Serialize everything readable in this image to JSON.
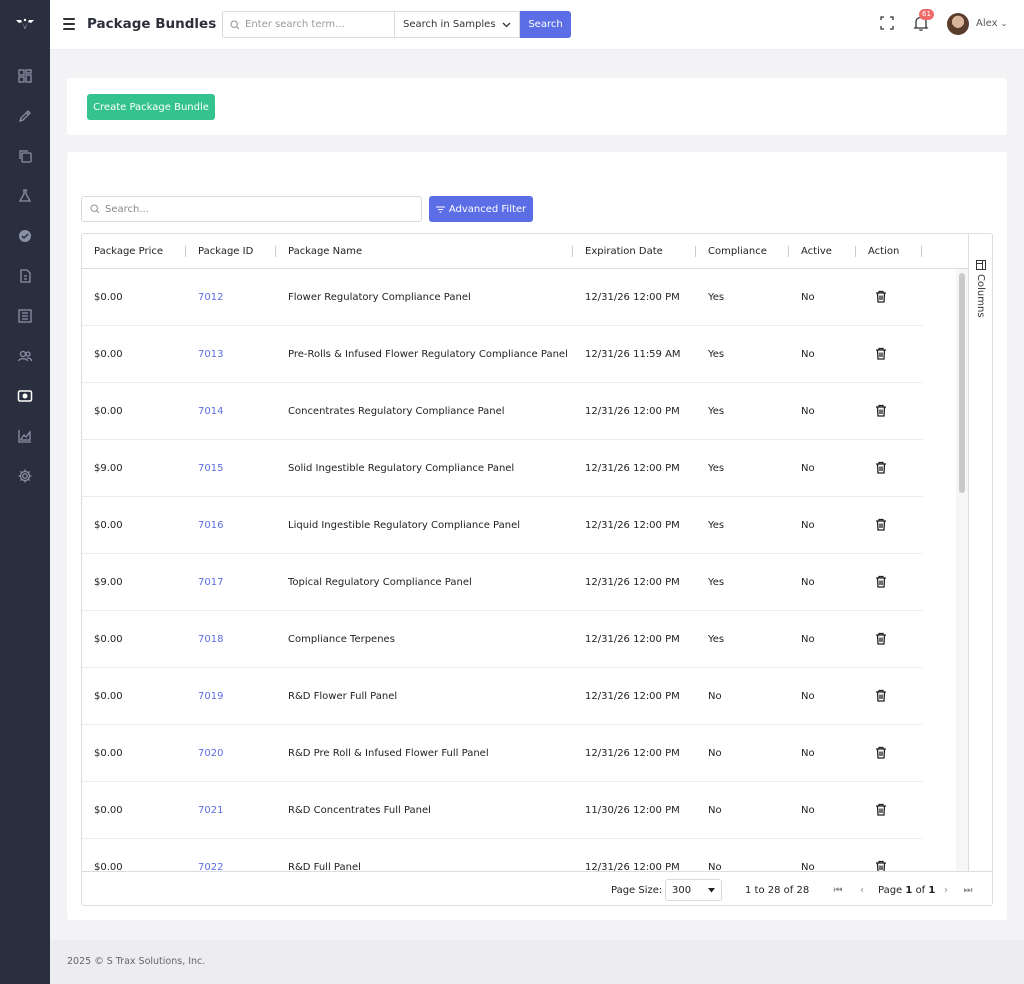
{
  "sidebar": {
    "logo": "trax-logo-icon",
    "items": [
      {
        "icon": "dashboard-icon"
      },
      {
        "icon": "pencil-icon"
      },
      {
        "icon": "copy-icon"
      },
      {
        "icon": "flask-icon"
      },
      {
        "icon": "verified-badge-icon"
      },
      {
        "icon": "document-icon"
      },
      {
        "icon": "list-icon"
      },
      {
        "icon": "users-icon"
      },
      {
        "icon": "package-icon"
      },
      {
        "icon": "area-chart-icon"
      },
      {
        "icon": "gear-icon"
      }
    ]
  },
  "header": {
    "title": "Package Bundles",
    "search_placeholder": "Enter search term...",
    "search_scope": "Search in Samples",
    "search_button": "Search",
    "notification_count": "61",
    "user_name": "Alex"
  },
  "toolbar": {
    "create_label": "Create Package Bundle"
  },
  "table": {
    "search_placeholder": "Search...",
    "filter_label": "Advanced Filter",
    "columns_label": "Columns",
    "headers": [
      "Package Price",
      "Package ID",
      "Package Name",
      "Expiration Date",
      "Compliance",
      "Active",
      "Action"
    ],
    "rows": [
      {
        "price": "$0.00",
        "id": "7012",
        "name": "Flower Regulatory Compliance Panel",
        "expiration": "12/31/26 12:00 PM",
        "compliance": "Yes",
        "active": "No"
      },
      {
        "price": "$0.00",
        "id": "7013",
        "name": "Pre-Rolls & Infused Flower Regulatory Compliance Panel",
        "expiration": "12/31/26 11:59 AM",
        "compliance": "Yes",
        "active": "No"
      },
      {
        "price": "$0.00",
        "id": "7014",
        "name": "Concentrates Regulatory Compliance Panel",
        "expiration": "12/31/26 12:00 PM",
        "compliance": "Yes",
        "active": "No"
      },
      {
        "price": "$9.00",
        "id": "7015",
        "name": "Solid Ingestible Regulatory Compliance Panel",
        "expiration": "12/31/26 12:00 PM",
        "compliance": "Yes",
        "active": "No"
      },
      {
        "price": "$0.00",
        "id": "7016",
        "name": "Liquid Ingestible Regulatory Compliance Panel",
        "expiration": "12/31/26 12:00 PM",
        "compliance": "Yes",
        "active": "No"
      },
      {
        "price": "$9.00",
        "id": "7017",
        "name": "Topical Regulatory Compliance Panel",
        "expiration": "12/31/26 12:00 PM",
        "compliance": "Yes",
        "active": "No"
      },
      {
        "price": "$0.00",
        "id": "7018",
        "name": "Compliance Terpenes",
        "expiration": "12/31/26 12:00 PM",
        "compliance": "Yes",
        "active": "No"
      },
      {
        "price": "$0.00",
        "id": "7019",
        "name": "R&D Flower Full Panel",
        "expiration": "12/31/26 12:00 PM",
        "compliance": "No",
        "active": "No"
      },
      {
        "price": "$0.00",
        "id": "7020",
        "name": "R&D Pre Roll & Infused Flower Full Panel",
        "expiration": "12/31/26 12:00 PM",
        "compliance": "No",
        "active": "No"
      },
      {
        "price": "$0.00",
        "id": "7021",
        "name": "R&D Concentrates Full Panel",
        "expiration": "11/30/26 12:00 PM",
        "compliance": "No",
        "active": "No"
      },
      {
        "price": "$0.00",
        "id": "7022",
        "name": "R&D Full Panel",
        "expiration": "12/31/26 12:00 PM",
        "compliance": "No",
        "active": "No"
      }
    ],
    "footer": {
      "page_size_label": "Page Size:",
      "page_size_value": "300",
      "range": "1 to 28 of 28",
      "page_prefix": "Page",
      "page_current": "1",
      "page_of": "of",
      "page_total": "1"
    }
  },
  "footer": {
    "copyright": "2025 © S Trax Solutions, Inc."
  },
  "colors": {
    "sidebar": "#2a2f3f",
    "primary": "#5b6ee6",
    "success": "#34c38f",
    "badge": "#f06a6a"
  }
}
